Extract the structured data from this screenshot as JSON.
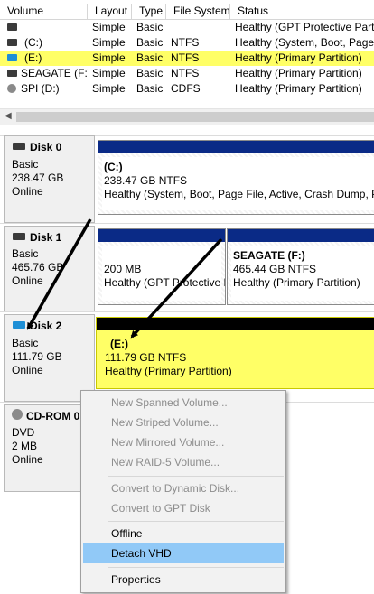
{
  "columns": [
    "Volume",
    "Layout",
    "Type",
    "File System",
    "Status"
  ],
  "volumes": [
    {
      "name": "",
      "layout": "Simple",
      "type": "Basic",
      "fs": "",
      "status": "Healthy (GPT Protective Partition)",
      "icon": "disk-drive-icon",
      "icon_color": "#3b3b3b"
    },
    {
      "name": "(C:)",
      "layout": "Simple",
      "type": "Basic",
      "fs": "NTFS",
      "status": "Healthy (System, Boot, Page File, Active, Crash Dump, Primary Partition)",
      "icon": "disk-drive-icon",
      "icon_color": "#3b3b3b"
    },
    {
      "name": "(E:)",
      "layout": "Simple",
      "type": "Basic",
      "fs": "NTFS",
      "status": "Healthy (Primary Partition)",
      "icon": "vhd-drive-icon",
      "icon_color": "#1e8fd6",
      "selected": true
    },
    {
      "name": "SEAGATE (F:)",
      "layout": "Simple",
      "type": "Basic",
      "fs": "NTFS",
      "status": "Healthy (Primary Partition)",
      "icon": "disk-drive-icon",
      "icon_color": "#3b3b3b"
    },
    {
      "name": "SPI (D:)",
      "layout": "Simple",
      "type": "Basic",
      "fs": "CDFS",
      "status": "Healthy (Primary Partition)",
      "icon": "cd-drive-icon",
      "icon_color": "#8a8a8a"
    }
  ],
  "disks": [
    {
      "name": "Disk 0",
      "kind": "Basic",
      "size": "238.47 GB",
      "state": "Online",
      "icon": "disk-drive-icon"
    },
    {
      "name": "Disk 1",
      "kind": "Basic",
      "size": "465.76 GB",
      "state": "Online",
      "icon": "disk-drive-icon"
    },
    {
      "name": "Disk 2",
      "kind": "Basic",
      "size": "111.79 GB",
      "state": "Online",
      "icon": "vhd-drive-icon"
    },
    {
      "name": "CD-ROM 0",
      "kind": "DVD",
      "size": "2 MB",
      "state": "Online",
      "icon": "cd-drive-icon"
    }
  ],
  "partitions": {
    "c": {
      "name": "(C:)",
      "size": "238.47 GB NTFS",
      "status": "Healthy (System, Boot, Page File, Active, Crash Dump, Primary Partition)"
    },
    "gpt": {
      "size": "200 MB",
      "status": "Healthy (GPT Protective Partition)"
    },
    "f": {
      "name": "SEAGATE  (F:)",
      "size": "465.44 GB NTFS",
      "status": "Healthy (Primary Partition)"
    },
    "e": {
      "name": "(E:)",
      "size": "111.79 GB NTFS",
      "status": "Healthy (Primary Partition)"
    }
  },
  "menu": [
    {
      "label": "New Spanned Volume...",
      "enabled": false
    },
    {
      "label": "New Striped Volume...",
      "enabled": false
    },
    {
      "label": "New Mirrored Volume...",
      "enabled": false
    },
    {
      "label": "New RAID-5 Volume...",
      "enabled": false
    },
    {
      "label": "Convert to Dynamic Disk...",
      "enabled": false
    },
    {
      "label": "Convert to GPT Disk",
      "enabled": false
    },
    {
      "label": "Offline",
      "enabled": true
    },
    {
      "label": "Detach VHD",
      "enabled": true,
      "highlighted": true
    },
    {
      "label": "Properties",
      "enabled": true
    }
  ],
  "colors": {
    "selection": "#ffff66",
    "partition_bar": "#0a2a86",
    "vhd_bar": "#000000",
    "menu_highlight": "#91c9f7",
    "vhd_icon": "#1e8fd6"
  }
}
